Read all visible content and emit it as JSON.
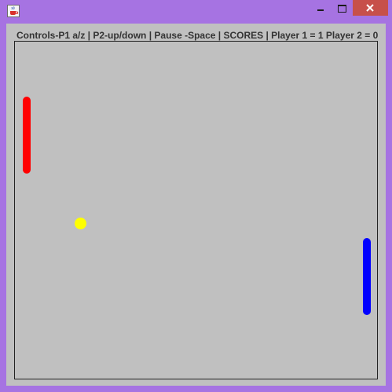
{
  "window": {
    "icon": "java-coffee-cup-icon",
    "controls": [
      "minimize-icon",
      "maximize-icon",
      "close-icon"
    ],
    "frame_color": "#a673e2",
    "close_color": "#c7504a"
  },
  "status_bar": {
    "text": "Controls-P1 a/z | P2-up/down | Pause -Space | SCORES |  Player 1 = 1  Player 2 = 0",
    "player1_score": 1,
    "player2_score": 0
  },
  "game": {
    "background": "#c0c0c0",
    "left_paddle_color": "#ff0000",
    "right_paddle_color": "#0000ff",
    "ball_color": "#ffff00"
  }
}
